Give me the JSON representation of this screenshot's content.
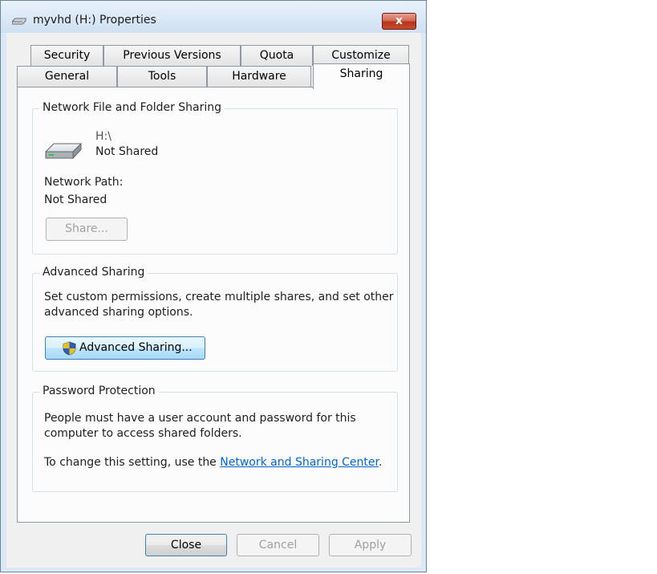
{
  "window": {
    "title": "myvhd (H:) Properties",
    "close_glyph": "x"
  },
  "tabs": {
    "row1": [
      "Security",
      "Previous Versions",
      "Quota",
      "Customize"
    ],
    "row2": [
      "General",
      "Tools",
      "Hardware",
      "Sharing"
    ],
    "active": "Sharing"
  },
  "network_sharing": {
    "group_title": "Network File and Folder Sharing",
    "drive_icon": "drive-icon",
    "drive_path": "H:\\",
    "drive_status": "Not Shared",
    "network_path_label": "Network Path:",
    "network_path_value": "Not Shared",
    "share_button": "Share..."
  },
  "advanced_sharing": {
    "group_title": "Advanced Sharing",
    "description_line1": "Set custom permissions, create multiple shares, and set other",
    "description_line2": "advanced sharing options.",
    "button_icon": "uac-shield-icon",
    "button_label": "Advanced Sharing..."
  },
  "password_protection": {
    "group_title": "Password Protection",
    "text_line1": "People must have a user account and password for this",
    "text_line2": "computer to access shared folders.",
    "change_text": "To change this setting, use the",
    "link_text": "Network and Sharing Center",
    "link_suffix": "."
  },
  "footer": {
    "close": "Close",
    "cancel": "Cancel",
    "apply": "Apply"
  }
}
